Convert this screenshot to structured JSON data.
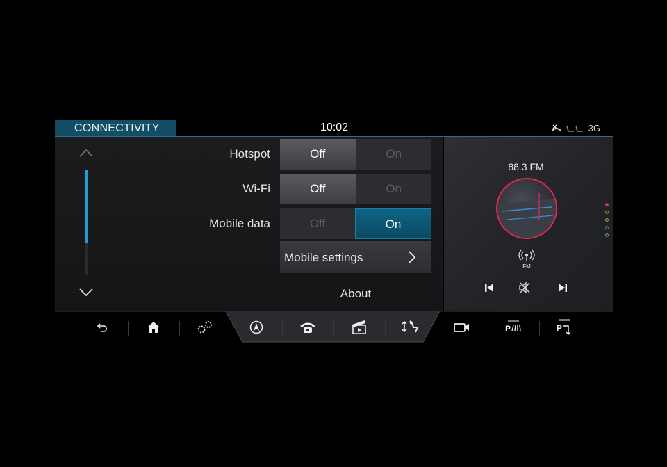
{
  "header": {
    "title": "CONNECTIVITY",
    "time": "10:02",
    "status_icons": [
      "phone-missed-icon",
      "seat-icon",
      "signal-3g-icon"
    ],
    "network": "3G"
  },
  "settings": {
    "rows": [
      {
        "label": "Hotspot",
        "off": "Off",
        "on": "On",
        "selected": "off"
      },
      {
        "label": "Wi-Fi",
        "off": "Off",
        "on": "On",
        "selected": "off"
      },
      {
        "label": "Mobile data",
        "off": "Off",
        "on": "On",
        "selected": "on"
      }
    ],
    "mobile_settings": "Mobile settings",
    "about": "About",
    "scroll_position": 0.7
  },
  "media": {
    "frequency": "88.3 FM",
    "source_label": "FM",
    "controls": [
      "previous-track-icon",
      "mute-icon",
      "next-track-icon"
    ],
    "page_dots": [
      "#e0304f",
      "#d4762a",
      "#8fb52e",
      "#2f86c9",
      "#8a8aa0"
    ]
  },
  "nav": {
    "items": [
      "back-icon",
      "home-icon",
      "settings-gears-icon",
      "navigation-icon",
      "phone-icon",
      "media-clapper-icon",
      "climate-icon",
      "camera-icon",
      "park-assist-icon",
      "park-exit-icon"
    ]
  },
  "colors": {
    "accent": "#134e66",
    "on_active": "#0f6383",
    "album_ring": "#e02a55"
  }
}
